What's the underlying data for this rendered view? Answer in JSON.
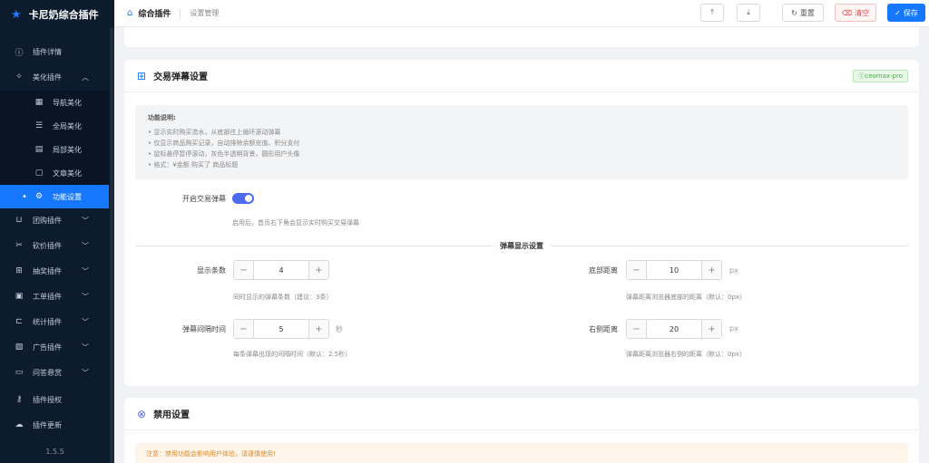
{
  "app": {
    "brand": "卡尼奶综合插件",
    "version": "1.5.5"
  },
  "sidebar": {
    "items": [
      {
        "label": "插件详情",
        "icon": "info-icon"
      },
      {
        "label": "美化插件",
        "icon": "magic-icon",
        "expanded": true
      },
      {
        "label": "导航美化",
        "icon": "grid-icon"
      },
      {
        "label": "全局美化",
        "icon": "sliders-icon"
      },
      {
        "label": "局部美化",
        "icon": "table-icon"
      },
      {
        "label": "文章美化",
        "icon": "file-icon"
      },
      {
        "label": "功能设置",
        "icon": "gear-icon",
        "active": true
      },
      {
        "label": "团购插件",
        "icon": "cart-icon"
      },
      {
        "label": "砍价插件",
        "icon": "scissors-icon"
      },
      {
        "label": "抽奖插件",
        "icon": "gift-icon"
      },
      {
        "label": "工单插件",
        "icon": "ticket-icon"
      },
      {
        "label": "统计插件",
        "icon": "chart-icon"
      },
      {
        "label": "广告插件",
        "icon": "image-icon"
      },
      {
        "label": "问答悬赏",
        "icon": "chat-icon"
      },
      {
        "label": "插件授权",
        "icon": "key-icon"
      },
      {
        "label": "插件更新",
        "icon": "cloud-icon"
      }
    ]
  },
  "header": {
    "breadcrumb_main": "综合插件",
    "breadcrumb_sub": "设置管理",
    "buttons": {
      "reset": "重置",
      "clear": "清空",
      "save": "保存"
    }
  },
  "trade_popup": {
    "title": "交易弹幕设置",
    "tag": "ceomax-pro",
    "desc_title": "功能说明:",
    "desc_lines": [
      "• 显示实时购买流水，从底部往上循环滚动弹幕",
      "• 仅显示商品购买记录，自动排除余额充值、积分支付",
      "• 鼠标悬停暂停滚动，灰色半透明背景，圆形用户头像",
      "• 格式：¥金额 购买了 商品标题"
    ],
    "enable_label": "开启交易弹幕",
    "enable_on": true,
    "enable_hint": "启用后，首页右下角会显示实时购买交易弹幕",
    "section_title": "弹幕显示设置",
    "display_count": {
      "label": "显示条数",
      "value": "4",
      "hint": "同时显示的弹幕条数（建议：3条）"
    },
    "bottom_distance": {
      "label": "底部距离",
      "value": "10",
      "unit": "px",
      "hint": "弹幕距离浏览器底部的距离（默认：0px）"
    },
    "interval": {
      "label": "弹幕间隔时间",
      "value": "5",
      "unit": "秒",
      "hint": "每条弹幕出现的间隔时间（默认：2.5秒）"
    },
    "right_distance": {
      "label": "右侧距离",
      "value": "20",
      "unit": "px",
      "hint": "弹幕距离浏览器右侧的距离（默认：0px）"
    },
    "stepper_minus": "−",
    "stepper_plus": "+"
  },
  "disable_section": {
    "title": "禁用设置",
    "warning": "注意：禁用功能会影响用户体验，请谨慎使用!"
  },
  "colors": {
    "primary": "#1677ff",
    "sidebar": "#0c1b2e",
    "toggle": "#4f6bed",
    "danger": "#e5484d",
    "tag": "#4aa84a"
  }
}
